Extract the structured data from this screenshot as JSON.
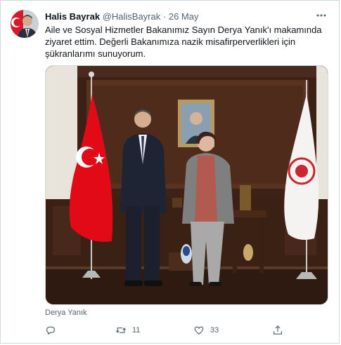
{
  "tweet": {
    "author_name": "Halis Bayrak",
    "handle": "@HalisBayrak",
    "separator": "·",
    "date": "26 May",
    "text": "Aile ve Sosyal Hizmetler Bakanımız Sayın Derya Yanık'ı makamında ziyaret ettim. Değerli Bakanımıza nazik misafirperverlikleri için şükranlarımı sunuyorum.",
    "tagged_user": "Derya Yanık"
  },
  "actions": {
    "reply_count": "",
    "retweet_count": "11",
    "like_count": "33"
  },
  "icons": {
    "more": "more-dots-icon",
    "reply": "reply-icon",
    "retweet": "retweet-icon",
    "like": "heart-icon",
    "share": "share-icon",
    "tag": "person-tag-icon"
  },
  "colors": {
    "text": "#0f1419",
    "secondary": "#536471",
    "border": "#cfd9de",
    "flag_red": "#e30a17"
  }
}
